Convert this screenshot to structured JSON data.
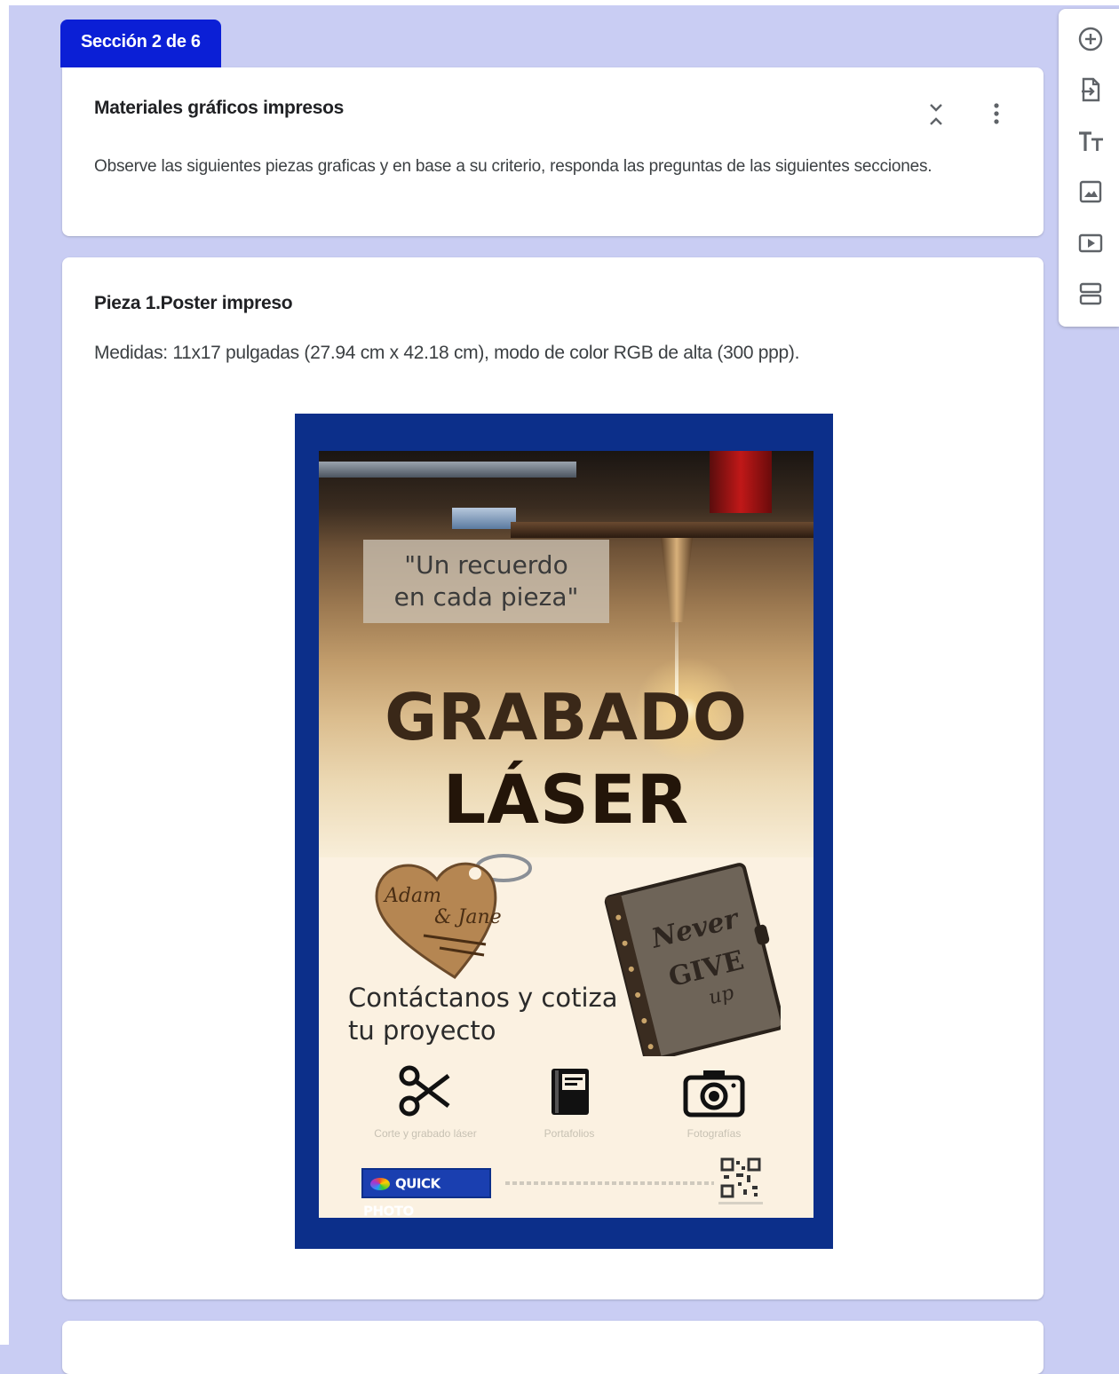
{
  "section_tab": {
    "label": "Sección 2 de 6"
  },
  "section": {
    "title": "Materiales gráficos impresos",
    "description": "Observe las siguientes piezas graficas y en base a su criterio, responda las preguntas de las siguientes secciones."
  },
  "piece": {
    "title": "Pieza 1.Poster impreso",
    "description": "Medidas: 11x17 pulgadas (27.94 cm x 42.18 cm), modo de color RGB de alta (300 ppp)."
  },
  "poster": {
    "quote_line1": "\"Un recuerdo",
    "quote_line2": "en cada pieza\"",
    "headline1": "GRABADO",
    "headline2": "LÁSER",
    "contact_line1": "Contáctanos y cotiza",
    "contact_line2": "tu proyecto",
    "keychain_text1": "Adam",
    "keychain_text2": "& Jane",
    "notebook_text1": "Never",
    "notebook_text2": "GIVE",
    "notebook_text3": "up",
    "services": [
      {
        "label": "Corte y grabado láser",
        "icon": "scissors-icon"
      },
      {
        "label": "Portafolios",
        "icon": "book-icon"
      },
      {
        "label": "Fotografías",
        "icon": "camera-icon"
      }
    ],
    "logo": "QUICK PHOTO"
  },
  "toolbar": [
    {
      "icon": "add-question-icon"
    },
    {
      "icon": "import-questions-icon"
    },
    {
      "icon": "add-title-icon"
    },
    {
      "icon": "add-image-icon"
    },
    {
      "icon": "add-video-icon"
    },
    {
      "icon": "add-section-icon"
    }
  ],
  "colors": {
    "background": "#c9cdf3",
    "tab": "#0b1fd6",
    "poster_border": "#0c2f8a"
  }
}
